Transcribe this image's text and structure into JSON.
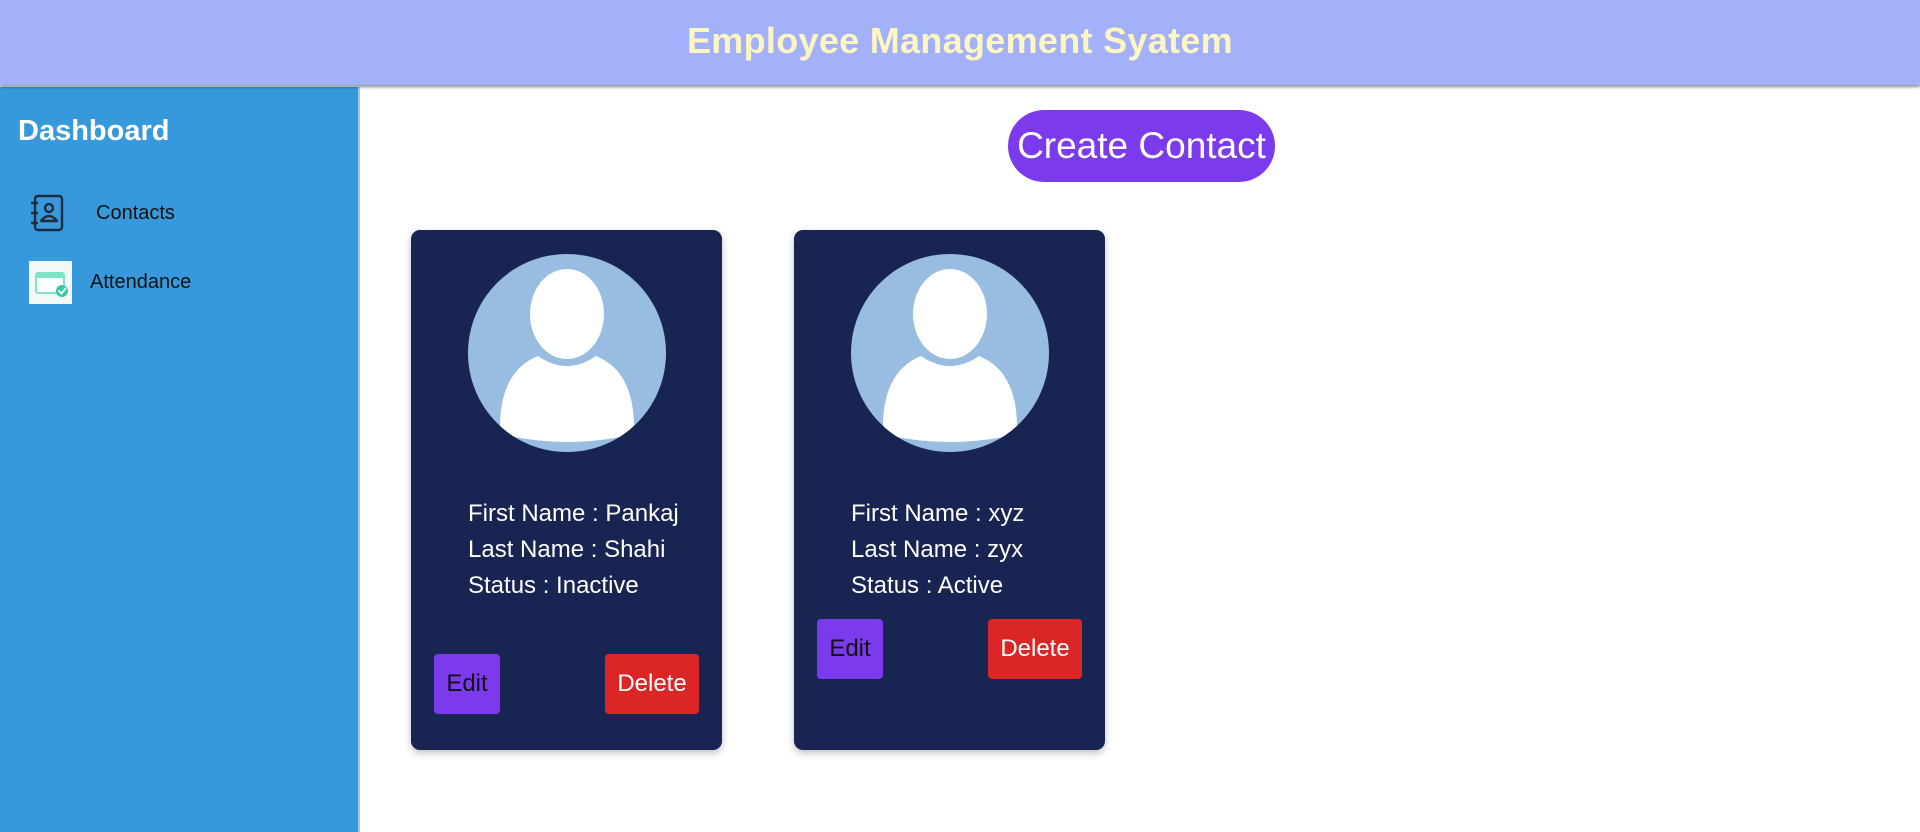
{
  "header": {
    "title": "Employee Management Syatem",
    "background": "#a3b1fb",
    "title_color": "#fdf6c1"
  },
  "sidebar": {
    "title": "Dashboard",
    "background": "#3799dc",
    "items": [
      {
        "label": "Contacts",
        "icon": "contact-book-icon"
      },
      {
        "label": "Attendance",
        "icon": "attendance-calendar-icon"
      }
    ]
  },
  "main": {
    "create_button_label": "Create Contact",
    "cards": [
      {
        "first_name_label": "First Name :",
        "first_name": "Pankaj",
        "last_name_label": "Last Name :",
        "last_name": "Shahi",
        "status_label": "Status :",
        "status": "Inactive",
        "edit_label": "Edit",
        "delete_label": "Delete"
      },
      {
        "first_name_label": "First Name :",
        "first_name": "xyz",
        "last_name_label": "Last Name :",
        "last_name": "zyx",
        "status_label": "Status :",
        "status": "Active",
        "edit_label": "Edit",
        "delete_label": "Delete"
      }
    ]
  },
  "colors": {
    "accent_purple": "#7c3aed",
    "delete_red": "#dc2626",
    "card_navy": "#182452",
    "avatar_blue": "#98bde0"
  }
}
